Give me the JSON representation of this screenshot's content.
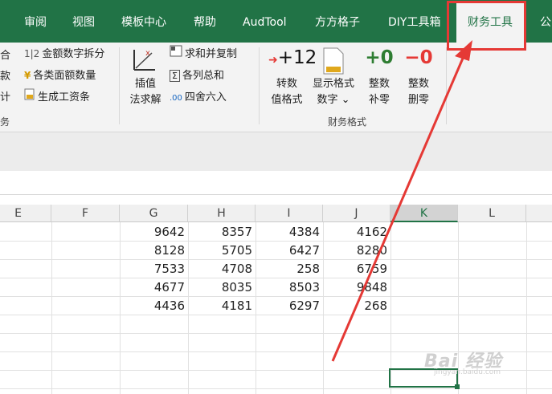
{
  "ribbon": {
    "tabs": [
      {
        "label": "审阅"
      },
      {
        "label": "视图"
      },
      {
        "label": "模板中心"
      },
      {
        "label": "帮助"
      },
      {
        "label": "AudTool"
      },
      {
        "label": "方方格子"
      },
      {
        "label": "DIY工具箱"
      },
      {
        "label": "财务工具"
      },
      {
        "label": "公"
      }
    ],
    "active_tab": "财务工具",
    "left_partial": [
      "合",
      "款",
      "计"
    ],
    "left_group_partial": "务",
    "small_buttons": [
      {
        "icon": "1|2",
        "label": "金额数字拆分"
      },
      {
        "icon": "¥",
        "label": "各类面额数量"
      },
      {
        "icon": "doc",
        "label": "生成工资条"
      },
      {
        "icon": "sum",
        "label": "求和并复制"
      },
      {
        "icon": "Σ",
        "label": "各列总和"
      },
      {
        "icon": ".00",
        "label": "四舍六入"
      }
    ],
    "interp_button": {
      "line1": "插值",
      "line2": "法求解"
    },
    "format_buttons": [
      {
        "icon": "+12",
        "line1": "转数",
        "line2": "值格式"
      },
      {
        "icon": "",
        "line1": "显示格式",
        "line2": "数字 ⌄"
      },
      {
        "icon": "+0",
        "line1": "整数",
        "line2": "补零"
      },
      {
        "icon": "−0",
        "line1": "整数",
        "line2": "删零"
      }
    ],
    "group_label": "财务格式",
    "colors": {
      "tab_bar": "#217346",
      "ribbon_bg": "#f3f3f3",
      "red_arrow": "#e53935"
    }
  },
  "grid": {
    "columns": [
      "E",
      "F",
      "G",
      "H",
      "I",
      "J",
      "K",
      "L"
    ],
    "selected_column": "K",
    "rows": [
      [
        "9642",
        "8357",
        "4384",
        "4162"
      ],
      [
        "8128",
        "5705",
        "6427",
        "8280"
      ],
      [
        "7533",
        "4708",
        "258",
        "6759"
      ],
      [
        "4677",
        "8035",
        "8503",
        "9848"
      ],
      [
        "4436",
        "4181",
        "6297",
        "268"
      ]
    ]
  },
  "watermark": {
    "line1": "Bai 经验",
    "line2": "jingyan.baidu.com"
  }
}
